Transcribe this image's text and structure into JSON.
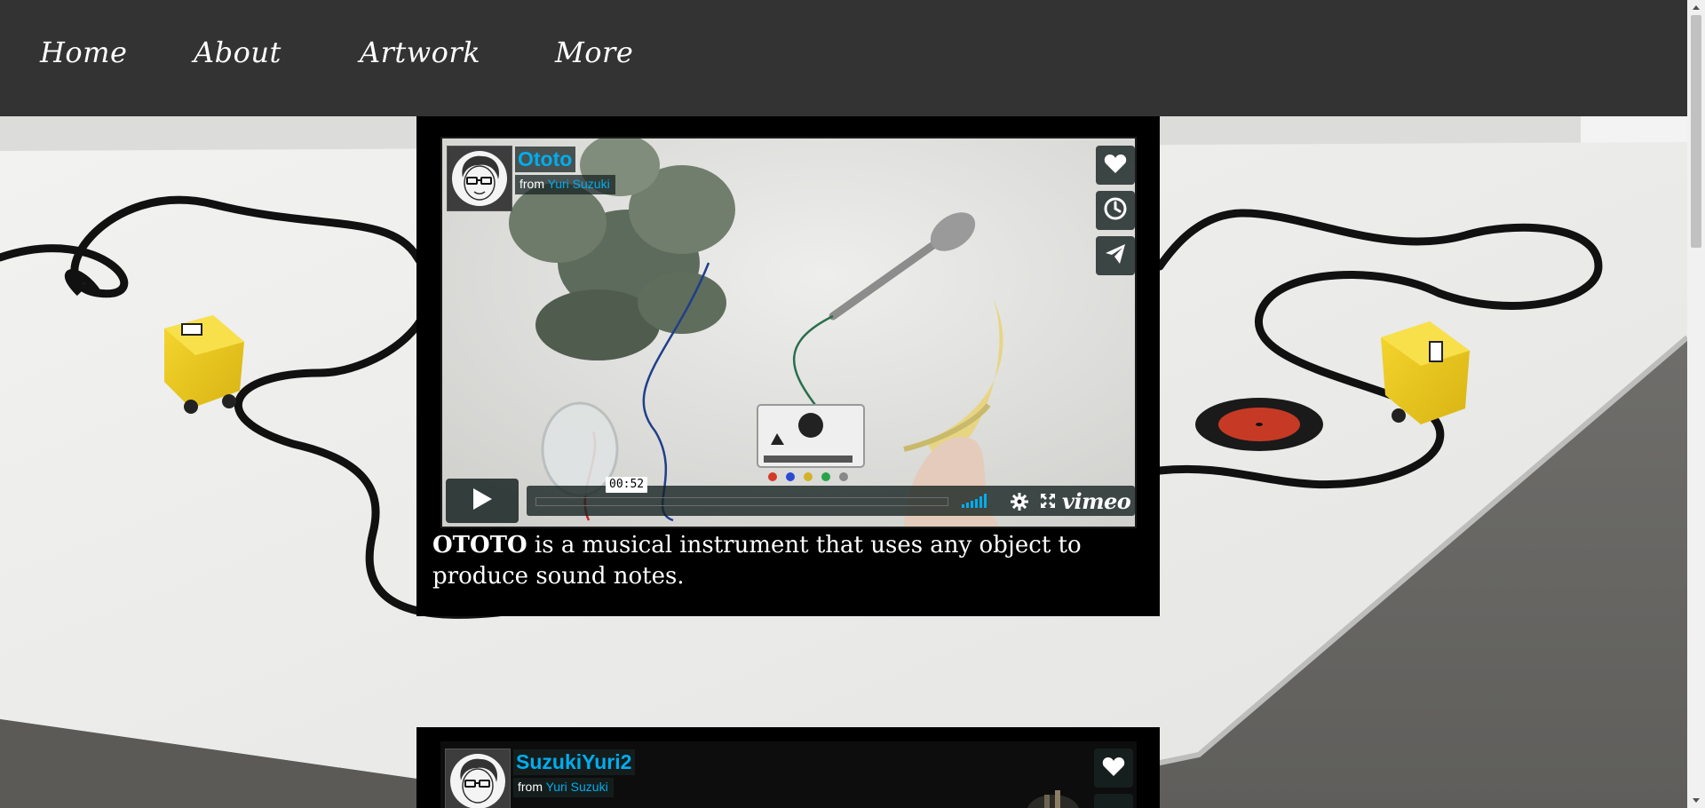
{
  "nav": {
    "items": [
      {
        "label": "Home"
      },
      {
        "label": "About"
      },
      {
        "label": "Artwork"
      },
      {
        "label": "More"
      }
    ]
  },
  "videos": [
    {
      "title": "Ototo",
      "from_label": "from",
      "author": "Yuri Suzuki",
      "hover_time": "00:52",
      "caption_bold": "OTOTO",
      "caption_rest": " is a musical instrument that uses any object to produce sound notes."
    },
    {
      "title": "SuzukiYuri2",
      "from_label": "from",
      "author": "Yuri Suzuki"
    }
  ],
  "player": {
    "logo": "vimeo",
    "icons": [
      "heart-icon",
      "clock-icon",
      "send-icon",
      "play-icon",
      "volume-icon",
      "gear-icon",
      "fullscreen-icon"
    ],
    "accent_color": "#00adef"
  },
  "colors": {
    "nav_background": "#333333",
    "panel_background": "#000000",
    "accent": "#00adef"
  }
}
